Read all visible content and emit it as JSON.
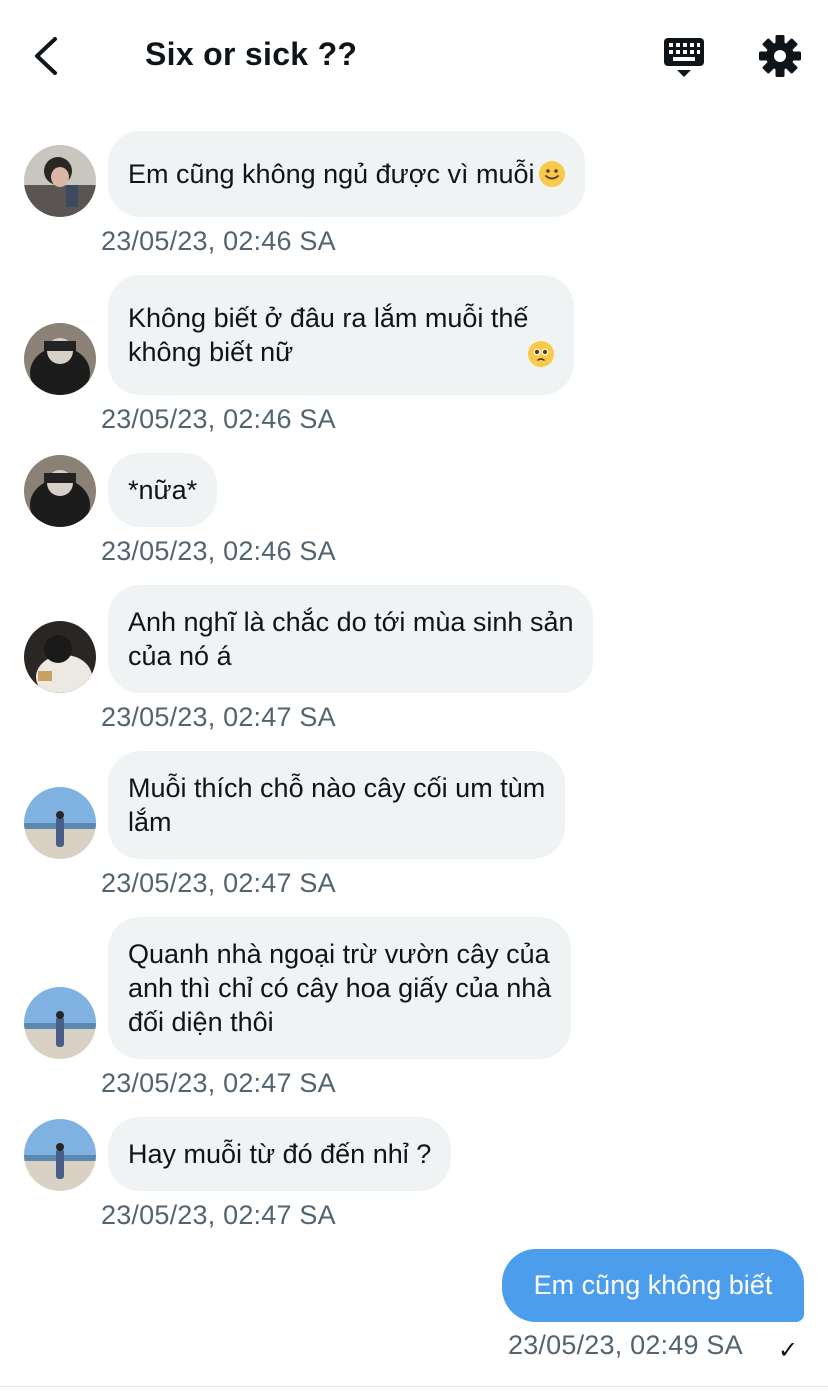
{
  "header": {
    "title": "Six or sick ??",
    "back_icon": "chevron-left-icon",
    "keyboard_icon": "keyboard-icon",
    "settings_icon": "gear-icon"
  },
  "messages": [
    {
      "text": "Em cũng không ngủ được vì muỗi",
      "emoji": "slightly-smiling-face",
      "time": "23/05/23, 02:46 SA"
    },
    {
      "text": "Không biết ở đâu ra lắm muỗi thế\nkhông biết nữ",
      "emoji": "pleading-face",
      "time": "23/05/23, 02:46 SA"
    },
    {
      "text": "*nữa*",
      "time": "23/05/23, 02:46 SA"
    },
    {
      "text": "Anh nghĩ là chắc do tới mùa sinh sản\ncủa nó á",
      "time": "23/05/23, 02:47 SA"
    },
    {
      "text": "Muỗi thích chỗ nào cây cối um tùm\nlắm",
      "time": "23/05/23, 02:47 SA"
    },
    {
      "text": "Quanh nhà ngoại trừ vườn cây của\nanh thì chỉ có cây hoa giấy của nhà\nđối diện thôi",
      "time": "23/05/23, 02:47 SA"
    },
    {
      "text": "Hay muỗi từ đó đến nhỉ ?",
      "time": "23/05/23, 02:47 SA"
    }
  ],
  "sent_message": {
    "text": "Em cũng không biết",
    "time": "23/05/23, 02:49 SA",
    "status": "✓"
  },
  "colors": {
    "received_bubble": "#eff3f4",
    "sent_bubble": "#4d9ded",
    "timestamp": "#536471"
  }
}
